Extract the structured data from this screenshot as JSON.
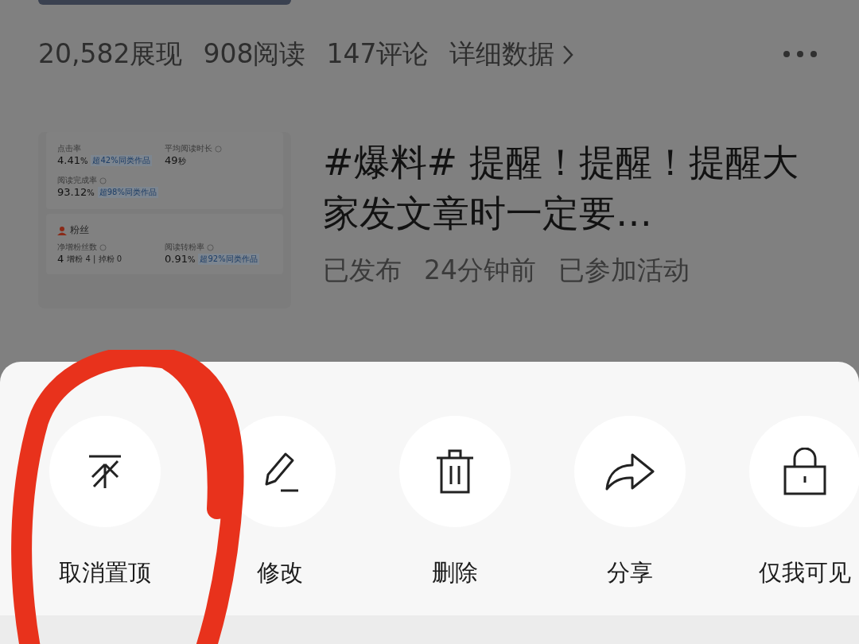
{
  "stats": [
    "20,582展现",
    "908阅读",
    "147评论"
  ],
  "details_link": "详细数据",
  "article": {
    "title": "#爆料# 提醒！提醒！提醒大家发文章时一定要…",
    "meta": [
      "已发布",
      "24分钟前",
      "已参加活动"
    ],
    "thumbnail": {
      "metrics": [
        {
          "label": "点击率",
          "info": false,
          "value": "4.41",
          "unit": "%",
          "badge": "超42%同类作品"
        },
        {
          "label": "平均阅读时长",
          "info": true,
          "value": "49",
          "unit": "秒"
        },
        {
          "label": "阅读完成率",
          "info": true,
          "value": "93.12",
          "unit": "%",
          "badge": "超98%同类作品"
        }
      ],
      "fans_title": "粉丝",
      "fans_metrics": [
        {
          "label": "净增粉丝数",
          "info": true,
          "value": "4",
          "note": "增粉 4 | 掉粉 0"
        },
        {
          "label": "阅读转粉率",
          "info": true,
          "value": "0.91",
          "unit": "%",
          "badge": "超92%同类作品"
        }
      ]
    }
  },
  "actions": [
    {
      "kind": "unpin",
      "label": "取消置顶"
    },
    {
      "kind": "edit",
      "label": "修改"
    },
    {
      "kind": "delete",
      "label": "删除"
    },
    {
      "kind": "share",
      "label": "分享"
    },
    {
      "kind": "private",
      "label": "仅我可见"
    }
  ]
}
